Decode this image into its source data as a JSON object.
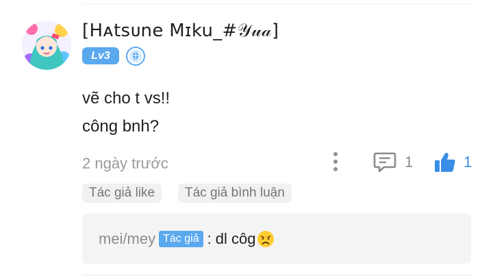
{
  "comment": {
    "username": "[Hᴀtsᴜne Mɪku_#𝒴𝓊𝒶]",
    "level_badge": "Lv3",
    "text_lines": [
      "vẽ cho t vs!!",
      "công bnh?"
    ],
    "timestamp": "2 ngày trước",
    "reply_count": "1",
    "like_count": "1"
  },
  "chips": {
    "author_liked": "Tác giả like",
    "author_replied": "Tác giả bình luận"
  },
  "reply": {
    "author": "mei/mey",
    "author_tag": "Tác giả",
    "separator": ":",
    "text": "dl côg"
  },
  "colors": {
    "accent": "#5aa8ee",
    "like_blue": "#3a8ee6",
    "muted_text": "#9a9a9a",
    "chip_bg": "#f1f1f1",
    "reply_bg": "#f4f4f4"
  },
  "icons": {
    "more": "vertical-dots-icon",
    "comment": "comment-bubble-icon",
    "like": "thumbs-up-icon",
    "rank": "diamond-rank-icon",
    "emoji": "disappointed-face-emoji"
  }
}
